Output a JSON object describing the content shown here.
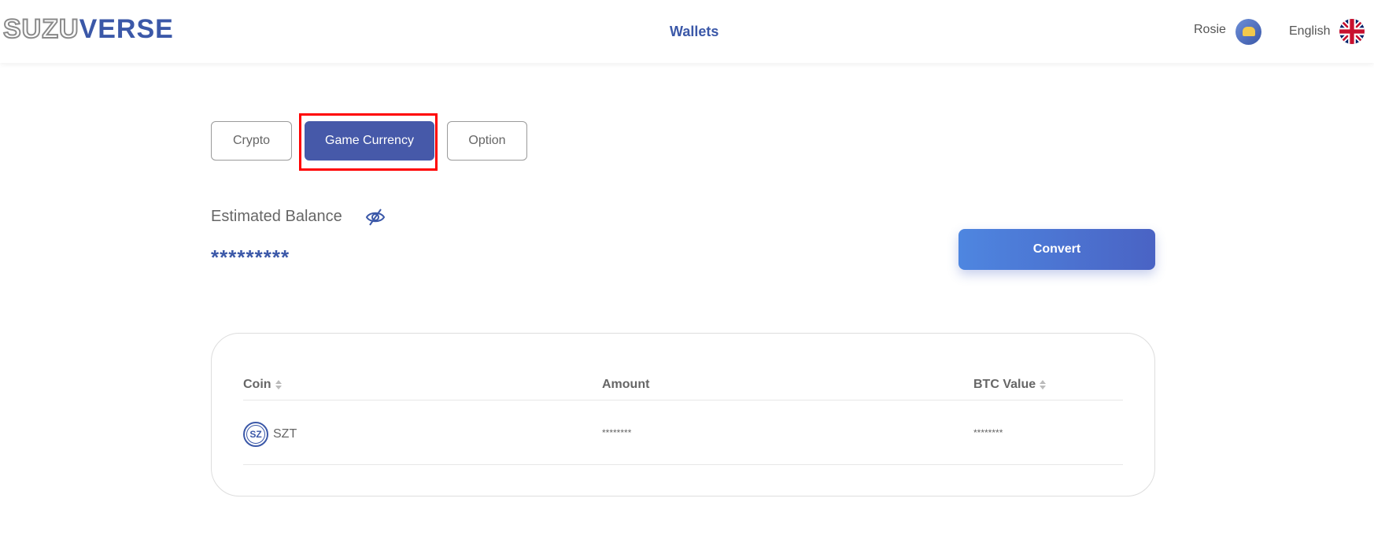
{
  "header": {
    "logo_part1": "SUZU",
    "logo_part2": "VERSE",
    "title": "Wallets",
    "user_name": "Rosie",
    "language": "English"
  },
  "tabs": [
    {
      "label": "Crypto",
      "active": false
    },
    {
      "label": "Game Currency",
      "active": true
    },
    {
      "label": "Option",
      "active": false
    }
  ],
  "balance": {
    "title": "Estimated Balance",
    "value": "*********",
    "visibility_icon": "eye-hidden-icon"
  },
  "convert_label": "Convert",
  "table": {
    "headers": {
      "coin": "Coin",
      "amount": "Amount",
      "btc_value": "BTC Value"
    },
    "rows": [
      {
        "logo_text": "SZ",
        "coin": "SZT",
        "amount": "********",
        "btc_value": "********"
      }
    ]
  },
  "colors": {
    "accent": "#3b58a8",
    "active_tab": "#4659a9",
    "highlight": "#ff0000"
  }
}
